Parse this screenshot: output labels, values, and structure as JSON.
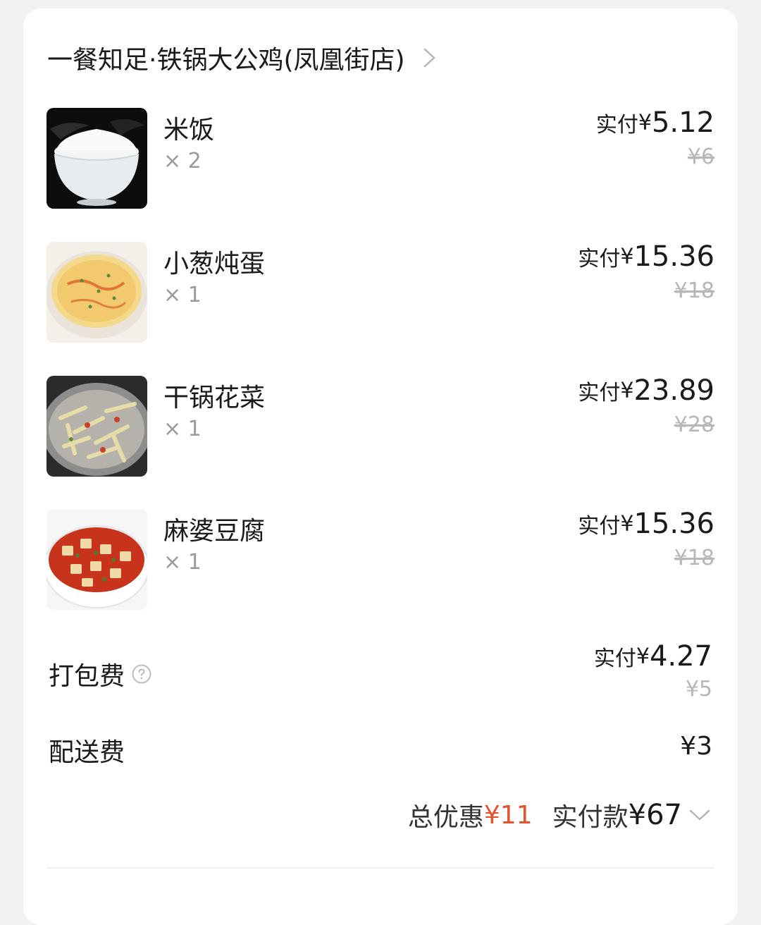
{
  "shop": {
    "name": "一餐知足·铁锅大公鸡(凤凰街店)"
  },
  "items": [
    {
      "name": "米饭",
      "qty": "× 2",
      "pay_label": "实付",
      "yen": "¥",
      "pay_amount": "5.12",
      "original": "¥6",
      "image": "rice-bowl-image"
    },
    {
      "name": "小葱炖蛋",
      "qty": "× 1",
      "pay_label": "实付",
      "yen": "¥",
      "pay_amount": "15.36",
      "original": "¥18",
      "image": "steamed-egg-image"
    },
    {
      "name": "干锅花菜",
      "qty": "× 1",
      "pay_label": "实付",
      "yen": "¥",
      "pay_amount": "23.89",
      "original": "¥28",
      "image": "dry-pot-cauliflower-image"
    },
    {
      "name": "麻婆豆腐",
      "qty": "× 1",
      "pay_label": "实付",
      "yen": "¥",
      "pay_amount": "15.36",
      "original": "¥18",
      "image": "mapo-tofu-image"
    }
  ],
  "packing": {
    "label": "打包费",
    "pay_label": "实付",
    "yen": "¥",
    "pay_amount": "4.27",
    "original": "¥5"
  },
  "delivery": {
    "label": "配送费",
    "value": "¥3"
  },
  "summary": {
    "discount_label": "总优惠",
    "discount_value": "¥11",
    "paid_label": "实付款",
    "paid_value": "¥67"
  },
  "colors": {
    "discount": "#e5532d",
    "strike": "#b7b7b7",
    "text": "#1a1a1a",
    "background": "#f2f2f2"
  },
  "icons": [
    "chevron-right-icon",
    "help-circle-icon",
    "chevron-down-icon"
  ]
}
